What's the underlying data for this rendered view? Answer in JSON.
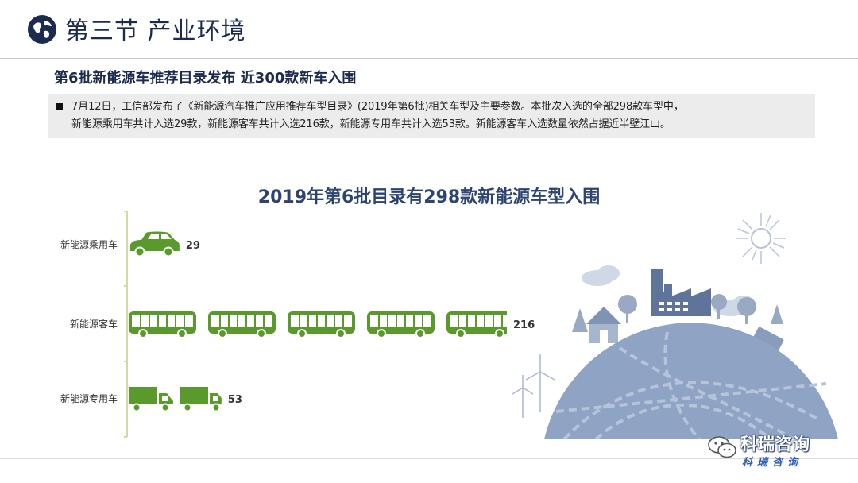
{
  "header": {
    "title": "第三节 产业环境"
  },
  "subtitle": "第6批新能源车推荐目录发布  近300款新车入围",
  "summary": {
    "text": "7月12日，工信部发布了《新能源汽车推广应用推荐车型目录》(2019年第6批)相关车型及主要参数。本批次入选的全部298款车型中，\n新能源乘用车共计入选29款，新能源客车共计入选216款，新能源专用车共计入选53款。新能源客车入选数量依然占据近半壁江山。"
  },
  "chart_data": {
    "type": "bar",
    "title": "2019年第6批目录有298款新能源车型入围",
    "orientation": "horizontal",
    "categories": [
      "新能源乘用车",
      "新能源客车",
      "新能源专用车"
    ],
    "values": [
      29,
      216,
      53
    ],
    "icons": [
      "car-icon",
      "bus-icon",
      "truck-icon"
    ],
    "xlim": [
      0,
      216
    ],
    "grid": false,
    "legend": "none"
  },
  "colors": {
    "bar_green": "#5a9a2c",
    "title_navy": "#2d4470",
    "scene_blue": "#8fa3c4"
  },
  "watermark": {
    "main": "科瑞咨询",
    "sub": "科瑞咨询"
  }
}
